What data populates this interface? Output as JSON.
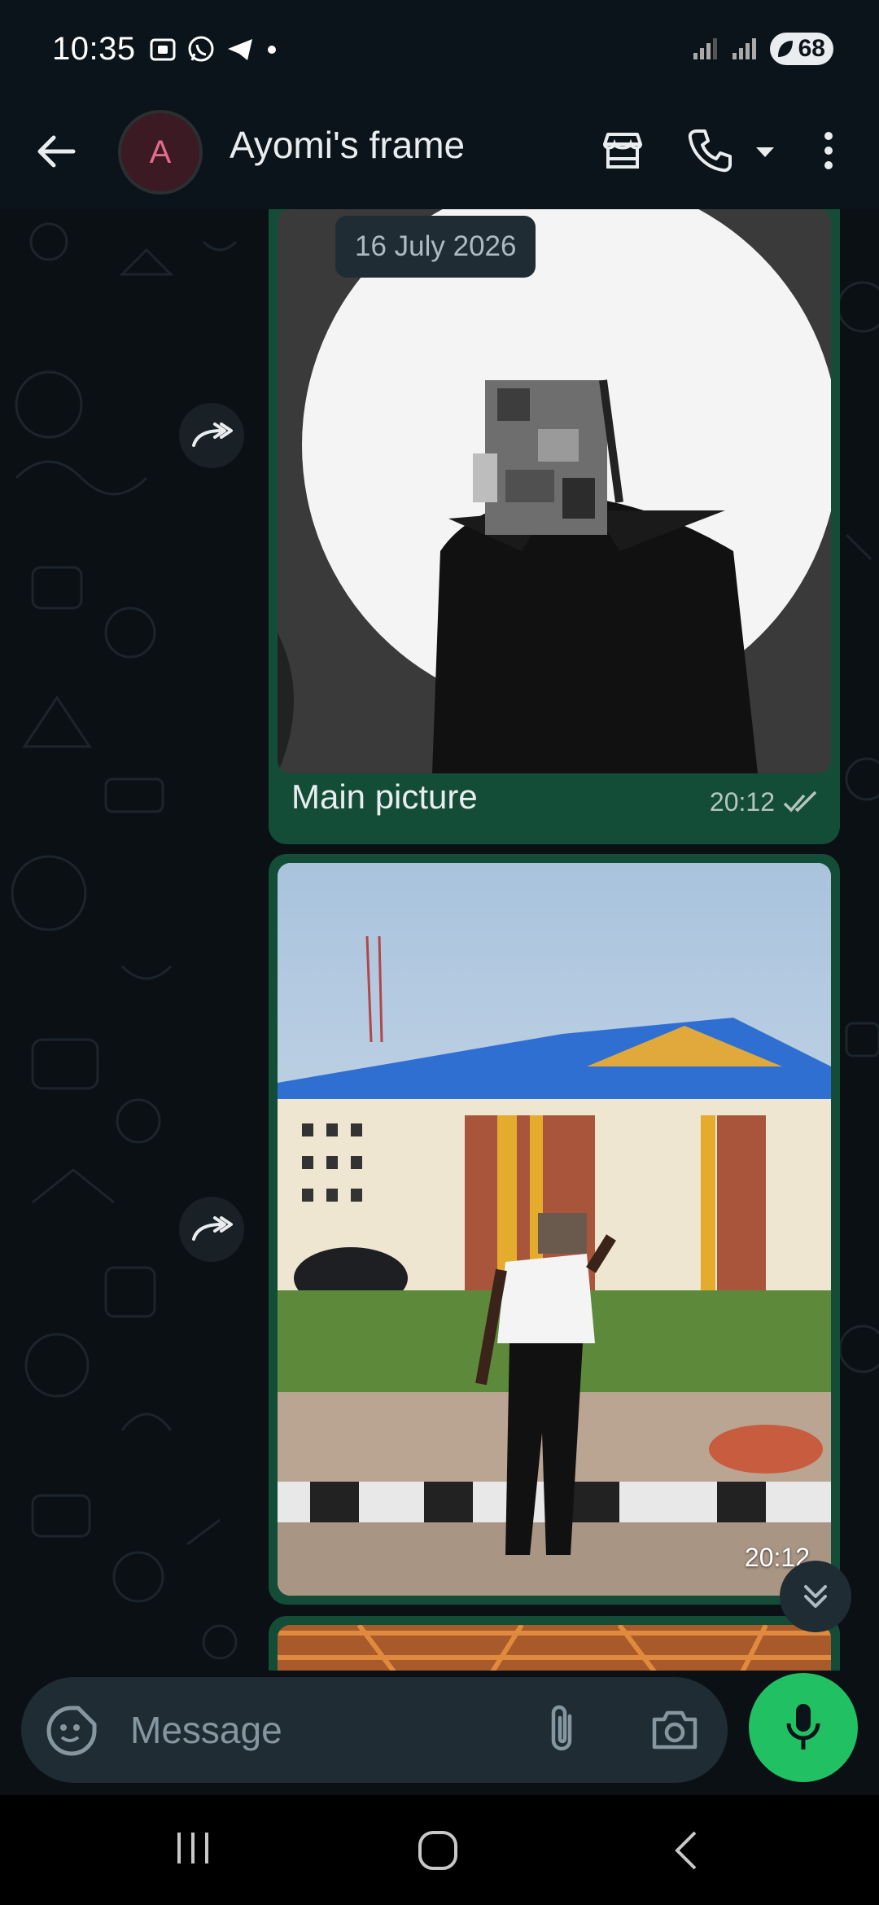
{
  "status_bar": {
    "time": "10:35",
    "battery": "68"
  },
  "header": {
    "avatar_letter": "A",
    "contact_name": "Ayomi's frame"
  },
  "chat": {
    "date_chip": "16 July 2026",
    "messages": [
      {
        "type": "image",
        "caption": "Main picture",
        "time": "20:12",
        "status": "read"
      },
      {
        "type": "image",
        "caption": "",
        "time": "20:12"
      },
      {
        "type": "image",
        "caption": "",
        "time": ""
      }
    ]
  },
  "composer": {
    "placeholder": "Message"
  },
  "colors": {
    "bubble": "#144d37",
    "accent": "#21c063",
    "header_bg": "#0b141a",
    "chat_bg": "#0b1014"
  },
  "icons": [
    "back-arrow-icon",
    "shop-icon",
    "phone-icon",
    "chevron-down-icon",
    "more-vertical-icon",
    "forward-icon",
    "double-check-icon",
    "scroll-down-icon",
    "sticker-icon",
    "attach-icon",
    "camera-icon",
    "mic-icon",
    "recent-apps-icon",
    "home-icon",
    "nav-back-icon"
  ]
}
